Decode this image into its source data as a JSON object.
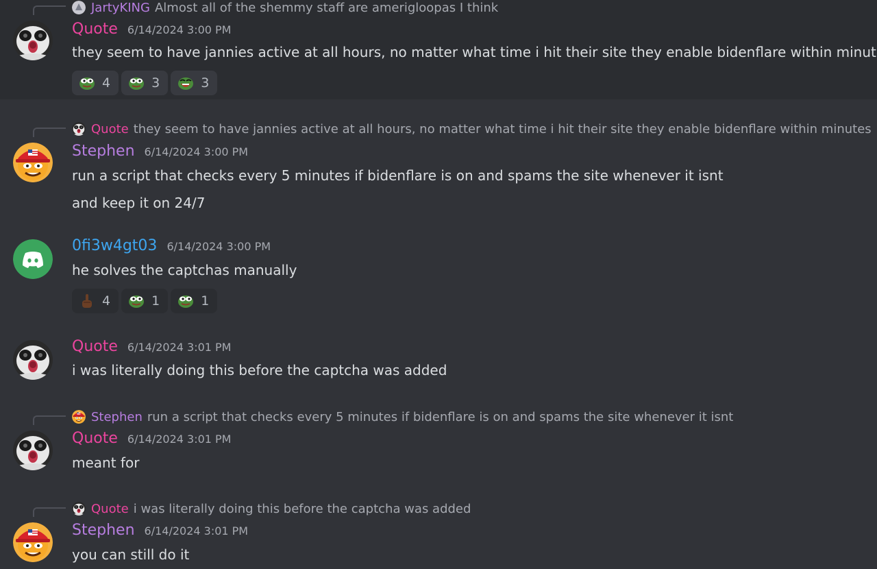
{
  "colors": {
    "background": "#313338",
    "highlight": "#2b2d31",
    "quote": "#eb459e",
    "stephen": "#b77ee0",
    "ofi": "#3ea6f0",
    "jarty": "#b77ee0"
  },
  "messages": [
    {
      "reply": {
        "author": "JartyKING",
        "text": "Almost all of the shemmy staff are amerigloopas I think"
      },
      "author": "Quote",
      "timestamp": "6/14/2024 3:00 PM",
      "lines": [
        "they seem to have jannies active at all hours, no matter what time i hit their site they enable bidenflare within minutes"
      ],
      "reactions": [
        {
          "emoji": "pepe-icon",
          "count": "4"
        },
        {
          "emoji": "pepe-icon",
          "count": "3"
        },
        {
          "emoji": "pepe-laugh-icon",
          "count": "3"
        }
      ]
    },
    {
      "reply": {
        "author": "Quote",
        "text": "they seem to have jannies active at all hours, no matter what time i hit their site they enable bidenflare within minutes"
      },
      "author": "Stephen",
      "timestamp": "6/14/2024 3:00 PM",
      "lines": [
        "run a script that checks every 5 minutes if bidenflare is on and spams the site whenever it isnt",
        "and keep it on 24/7"
      ]
    },
    {
      "author": "0fi3w4gt03",
      "timestamp": "6/14/2024 3:00 PM",
      "lines": [
        "he solves the captchas manually"
      ],
      "reactions": [
        {
          "emoji": "pointing-finger-icon",
          "count": "4"
        },
        {
          "emoji": "pepe-icon",
          "count": "1"
        },
        {
          "emoji": "pepe-icon",
          "count": "1"
        }
      ]
    },
    {
      "author": "Quote",
      "timestamp": "6/14/2024 3:01 PM",
      "lines": [
        "i was literally doing this before the captcha was added"
      ]
    },
    {
      "reply": {
        "author": "Stephen",
        "text": "run a script that checks every 5 minutes if bidenflare is on and spams the site whenever it isnt"
      },
      "author": "Quote",
      "timestamp": "6/14/2024 3:01 PM",
      "lines": [
        "meant for"
      ]
    },
    {
      "reply": {
        "author": "Quote",
        "text": "i was literally doing this before the captcha was added"
      },
      "author": "Stephen",
      "timestamp": "6/14/2024 3:01 PM",
      "lines": [
        "you can still do it"
      ]
    }
  ]
}
